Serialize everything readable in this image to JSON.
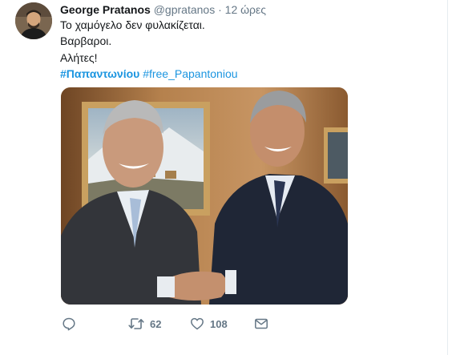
{
  "tweet": {
    "author_name": "George Pratanos",
    "author_handle": "@gpratanos",
    "separator": "·",
    "timestamp": "12 ώρες",
    "lines": [
      "Το χαμόγελο δεν φυλακίζεται.",
      "Βαρβαροι.",
      "Αλήτες!"
    ],
    "hashtags": [
      "#Παπαντωνίου",
      "#free_Papantoniou"
    ]
  },
  "actions": {
    "retweet_count": "62",
    "like_count": "108"
  },
  "icons": {
    "reply": "reply-icon",
    "retweet": "retweet-icon",
    "like": "heart-icon",
    "dm": "envelope-icon"
  },
  "colors": {
    "link": "#1b95e0",
    "muted": "#657786"
  }
}
